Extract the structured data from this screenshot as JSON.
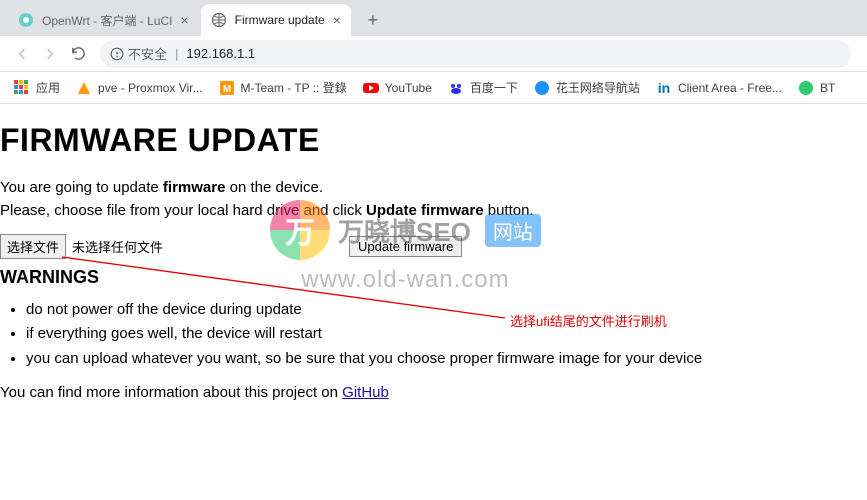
{
  "browser": {
    "tabs": [
      {
        "title": "OpenWrt - 客户端 - LuCI"
      },
      {
        "title": "Firmware update"
      }
    ],
    "address": {
      "insecure_label": "不安全",
      "url": "192.168.1.1"
    },
    "bookmarks": {
      "apps_label": "应用",
      "items": [
        {
          "label": "pve - Proxmox Vir..."
        },
        {
          "label": "M-Team - TP :: 登錄"
        },
        {
          "label": "YouTube"
        },
        {
          "label": "百度一下"
        },
        {
          "label": "花王网络导航站"
        },
        {
          "label": "Client Area - Free..."
        },
        {
          "label": "BT"
        }
      ]
    }
  },
  "page": {
    "heading": "FIRMWARE UPDATE",
    "intro_line1_pre": "You are going to update ",
    "intro_line1_bold": "firmware",
    "intro_line1_post": " on the device.",
    "intro_line2_pre": "Please, choose file from your local hard drive and click ",
    "intro_line2_bold": "Update firmware",
    "intro_line2_post": " button.",
    "file_button": "选择文件",
    "file_status": "未选择任何文件",
    "update_button": "Update firmware",
    "warnings_heading": "WARNINGS",
    "warnings": [
      "do not power off the device during update",
      "if everything goes well, the device will restart",
      "you can upload whatever you want, so be sure that you choose proper firmware image for your device"
    ],
    "more_pre": "You can find more information about this project on ",
    "more_link": "GitHub"
  },
  "annotation": {
    "text": "选择ufi结尾的文件进行刷机"
  },
  "watermark": {
    "brand": "万晓博SEO",
    "badge": "网站",
    "url": "www.old-wan.com",
    "logo_char": "万"
  }
}
